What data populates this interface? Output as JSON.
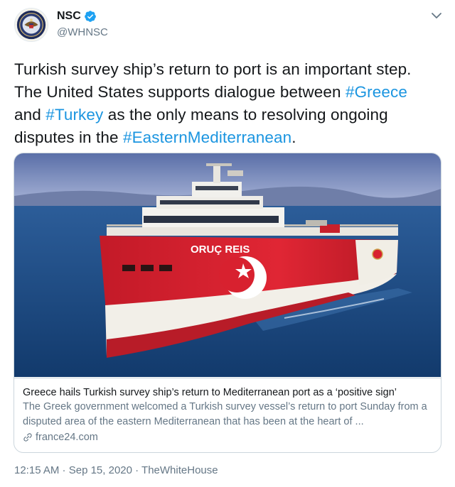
{
  "tweet": {
    "author": {
      "name": "NSC",
      "handle": "@WHNSC",
      "verified": true,
      "avatar_icon": "presidential-seal-icon"
    },
    "text": {
      "line1": "Turkish survey ship’s return to port is an important step.",
      "line2_pre": "The United States supports dialogue between ",
      "tag_greece": "#Greece",
      "line3_pre": "and ",
      "tag_turkey": "#Turkey",
      "line3_post": " as the only means to resolving ongoing",
      "line4_pre": "disputes in the ",
      "tag_med": "#EasternMediterranean",
      "line4_post": "."
    },
    "card": {
      "ship_name": "ORUÇ REIS",
      "title": "Greece hails Turkish survey ship’s return to Mediterranean port as a ‘positive sign’",
      "description": "The Greek government welcomed a Turkish survey vessel’s return to port Sunday from a disputed area of the eastern Mediterranean that has been at the heart of ...",
      "domain": "france24.com"
    },
    "meta": {
      "time": "12:15 AM",
      "separator": " · ",
      "date": "Sep 15, 2020",
      "source": "TheWhiteHouse"
    }
  },
  "colors": {
    "link": "#1b95e0",
    "secondary_text": "#657786",
    "hull_red": "#d8212f",
    "sea": "#1e4f86"
  }
}
